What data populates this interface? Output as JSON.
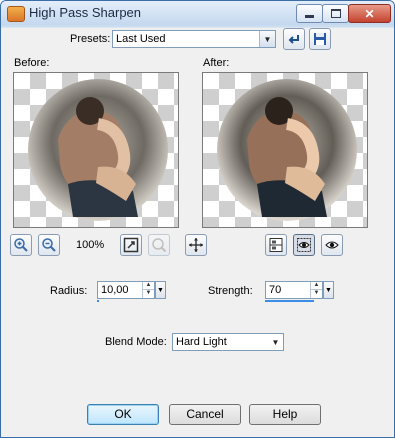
{
  "window": {
    "title": "High Pass Sharpen"
  },
  "presets": {
    "label": "Presets:",
    "value": "Last Used"
  },
  "preview": {
    "before_label": "Before:",
    "after_label": "After:"
  },
  "zoom": {
    "value": "100%"
  },
  "radius": {
    "label": "Radius:",
    "value": "10,00"
  },
  "strength": {
    "label": "Strength:",
    "value": "70"
  },
  "blend_mode": {
    "label": "Blend Mode:",
    "value": "Hard Light"
  },
  "buttons": {
    "ok": "OK",
    "cancel": "Cancel",
    "help": "Help"
  },
  "colors": {
    "accent": "#3b8ee6",
    "title_bar": "#c4d8ee",
    "close_button": "#c4432f"
  }
}
